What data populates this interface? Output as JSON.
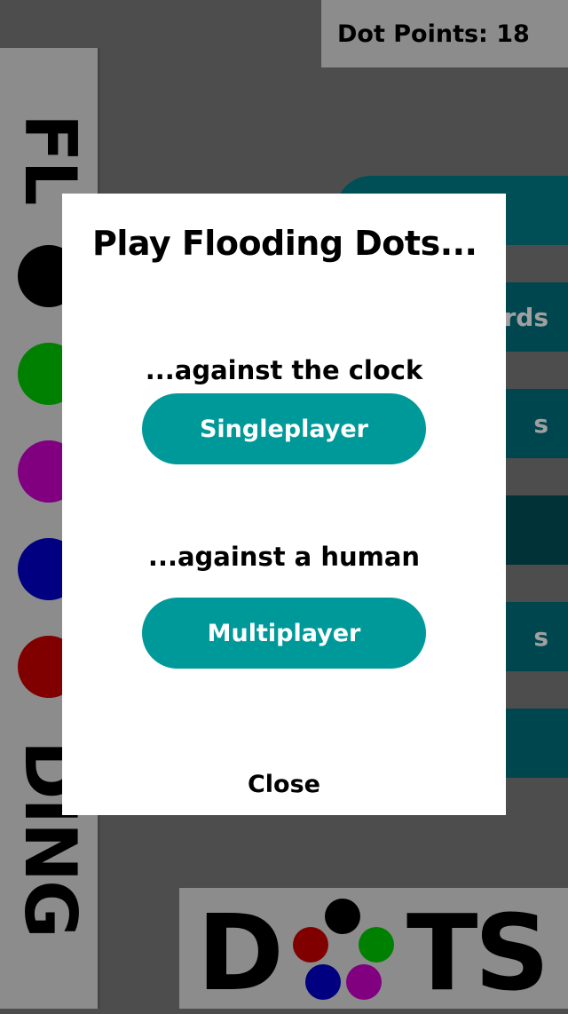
{
  "header": {
    "dot_points": "Dot Points: 18"
  },
  "side_title": {
    "top": "FL",
    "bottom": "DING"
  },
  "side_dots": [
    "#000000",
    "#008000",
    "#800080",
    "#000080",
    "#800000"
  ],
  "menu": {
    "items": [
      {
        "label": ""
      },
      {
        "label": "rds"
      },
      {
        "label": "s"
      },
      {
        "label": ""
      },
      {
        "label": "s"
      },
      {
        "label": ""
      }
    ]
  },
  "logo": {
    "left": "D",
    "right": "TS",
    "dot_colors": [
      "#000000",
      "#800000",
      "#008000",
      "#000080",
      "#800080"
    ]
  },
  "modal": {
    "title": "Play Flooding Dots...",
    "singleplayer_caption": "...against the clock",
    "singleplayer_label": "Singleplayer",
    "multiplayer_caption": "...against a human",
    "multiplayer_label": "Multiplayer",
    "close_label": "Close"
  },
  "colors": {
    "accent": "#00999a",
    "menu_bg": "#00464e",
    "panel": "#8c8c8c",
    "backdrop": "#4d4d4d"
  }
}
